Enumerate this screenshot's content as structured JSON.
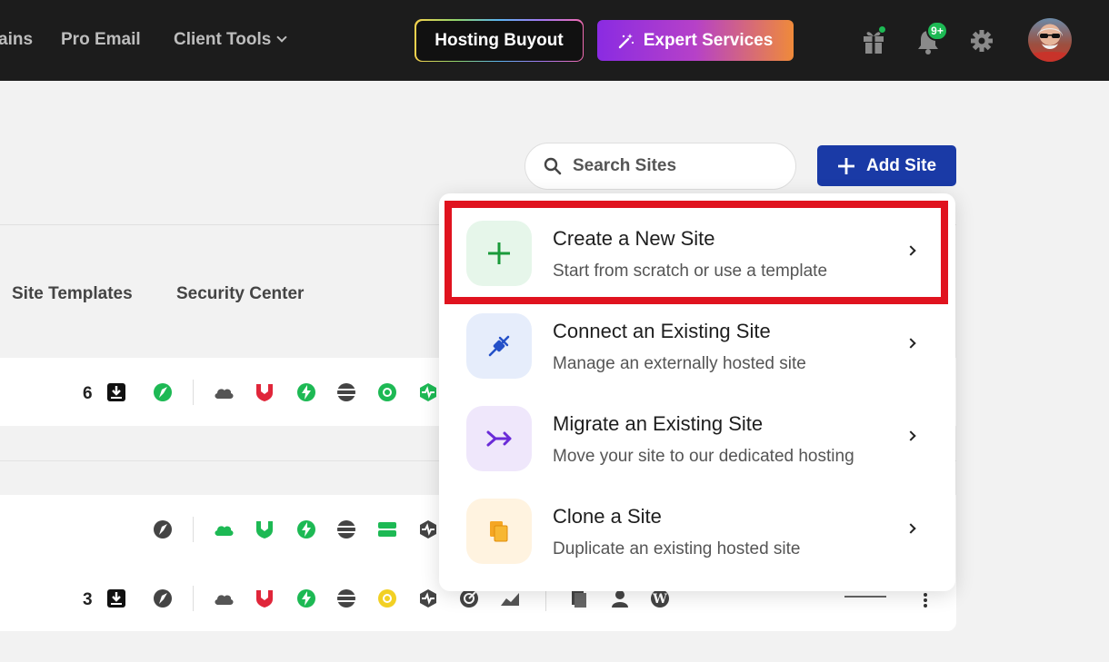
{
  "topbar": {
    "nav": [
      {
        "label": "ains"
      },
      {
        "label": "Pro Email"
      },
      {
        "label": "Client Tools"
      }
    ],
    "hosting_buyout": "Hosting Buyout",
    "expert_services": "Expert Services",
    "notification_badge": "9+"
  },
  "toolbar": {
    "search_placeholder": "Search Sites",
    "add_site_label": "Add Site"
  },
  "tabs": [
    {
      "label": "Site Templates"
    },
    {
      "label": "Security Center"
    }
  ],
  "rows": [
    {
      "count": "6"
    },
    {
      "count": ""
    },
    {
      "count": "3"
    }
  ],
  "dropdown": {
    "items": [
      {
        "title": "Create a New Site",
        "subtitle": "Start from scratch or use a template",
        "icon": "plus-icon",
        "icon_bg": "#e6f6ea",
        "icon_color": "#1a9a3a"
      },
      {
        "title": "Connect an Existing Site",
        "subtitle": "Manage an externally hosted site",
        "icon": "plug-icon",
        "icon_bg": "#e6edfb",
        "icon_color": "#2450c8"
      },
      {
        "title": "Migrate an Existing Site",
        "subtitle": "Move your site to our dedicated hosting",
        "icon": "migrate-icon",
        "icon_bg": "#efe7fb",
        "icon_color": "#6a2bd8"
      },
      {
        "title": "Clone a Site",
        "subtitle": "Duplicate an existing hosted site",
        "icon": "copy-icon",
        "icon_bg": "#fff3e0",
        "icon_color": "#f5a623"
      }
    ]
  },
  "colors": {
    "highlight": "#e0131f",
    "primary": "#1a3aa6",
    "success": "#1db954"
  }
}
